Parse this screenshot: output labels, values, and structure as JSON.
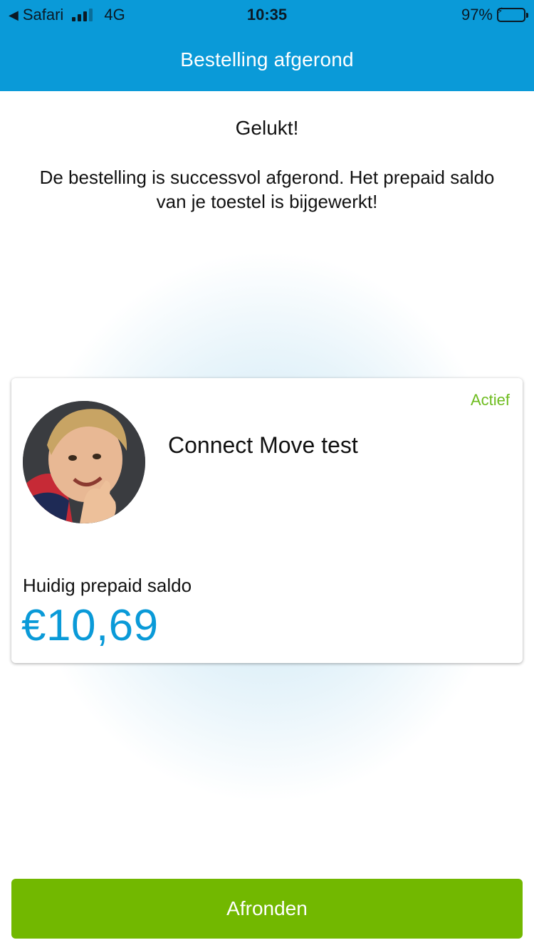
{
  "status_bar": {
    "back_app": "Safari",
    "network": "4G",
    "time": "10:35",
    "battery": "97%",
    "battery_level": 0.97
  },
  "header": {
    "title": "Bestelling afgerond"
  },
  "content": {
    "title": "Gelukt!",
    "message": "De bestelling is successvol afgerond. Het prepaid saldo van je toestel is bijgewerkt!"
  },
  "card": {
    "status": "Actief",
    "device_name": "Connect Move test",
    "balance_label": "Huidig prepaid saldo",
    "balance": "€10,69"
  },
  "actions": {
    "finish_label": "Afronden"
  },
  "colors": {
    "header": "#0a9ad8",
    "accent_green": "#72b800",
    "status_green": "#6ebc1f",
    "balance_blue": "#0a9ad8"
  }
}
